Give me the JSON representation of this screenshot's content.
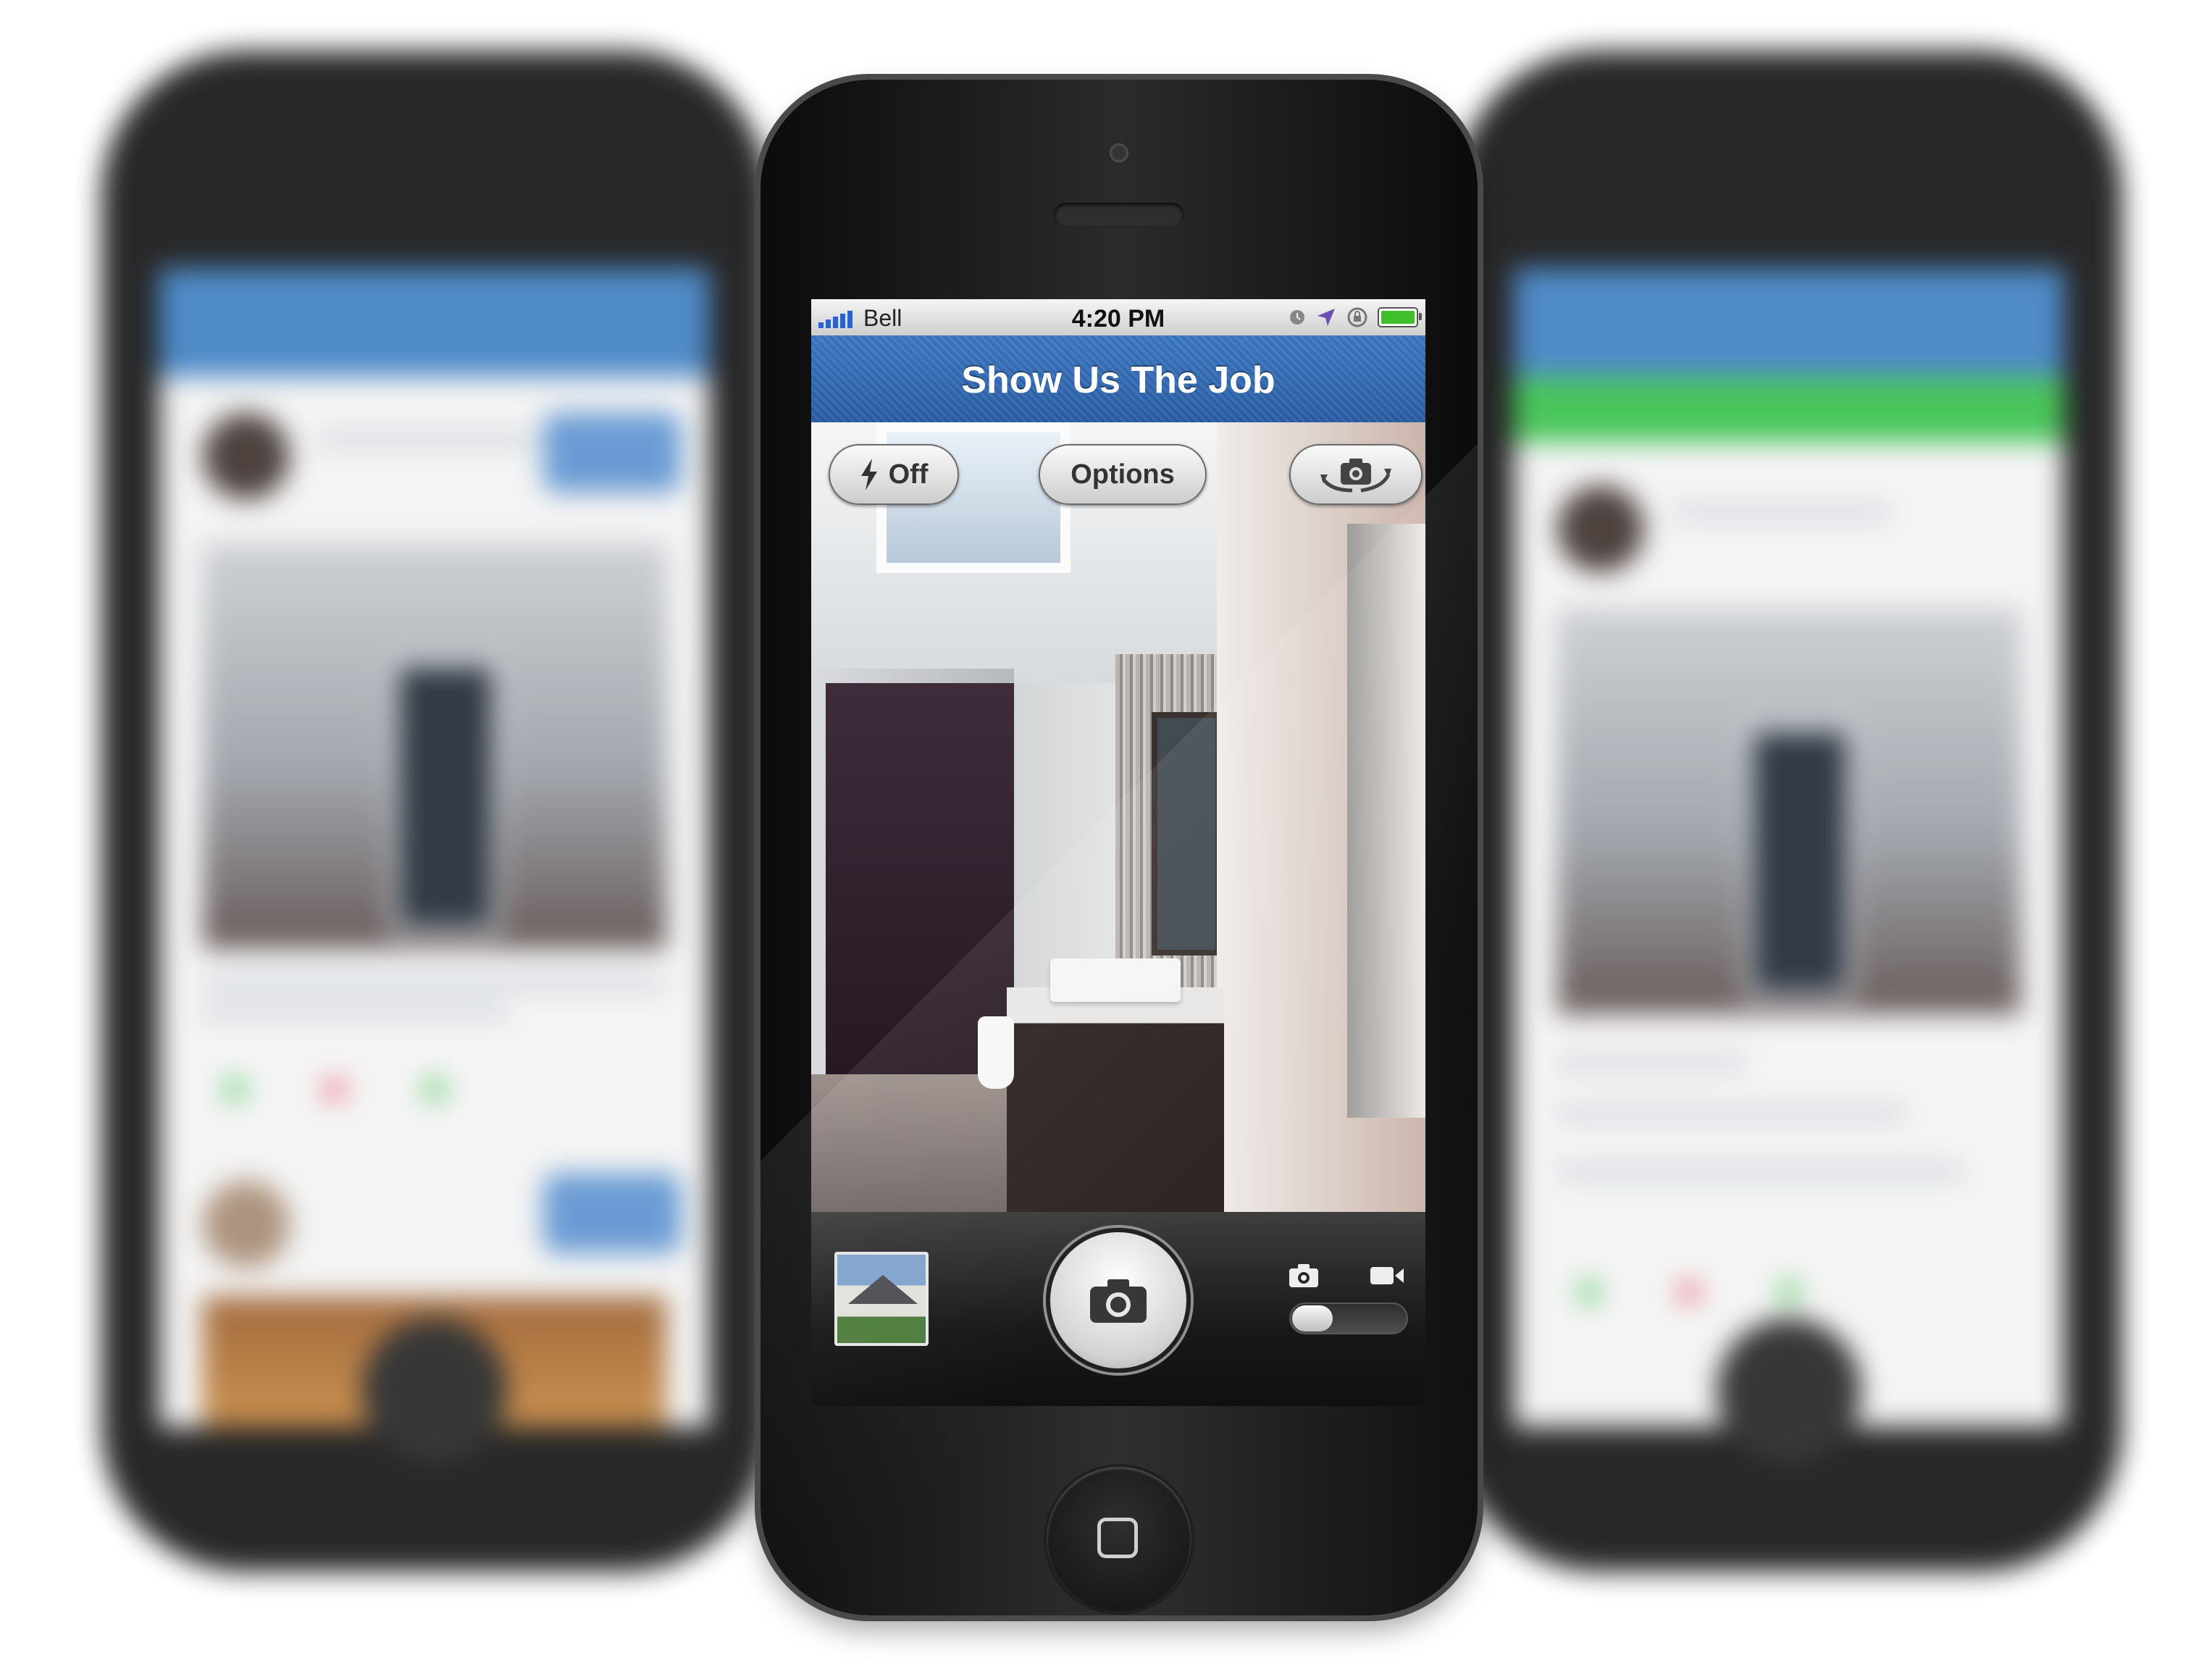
{
  "status_bar": {
    "carrier": "Bell",
    "time": "4:20 PM",
    "icons": [
      "signal-bars-icon",
      "lock-rotation-icon",
      "location-arrow-icon",
      "alarm-icon",
      "battery-icon"
    ]
  },
  "nav_bar": {
    "title": "Show Us The Job"
  },
  "camera": {
    "flash_label": "Off",
    "flash_icon": "lightning-bolt-icon",
    "options_label": "Options",
    "switch_camera_icon": "camera-flip-icon",
    "shutter_icon": "camera-icon",
    "last_photo_thumbnail": "house-photo-thumbnail",
    "mode_photo_icon": "photo-mode-icon",
    "mode_video_icon": "video-mode-icon",
    "mode_selected": "photo"
  },
  "colors": {
    "nav_bar_blue": "#3c78c2",
    "battery_green": "#3fbf2a",
    "background_left_nav": "#3c7fc3",
    "background_right_banner": "#36c04a"
  }
}
